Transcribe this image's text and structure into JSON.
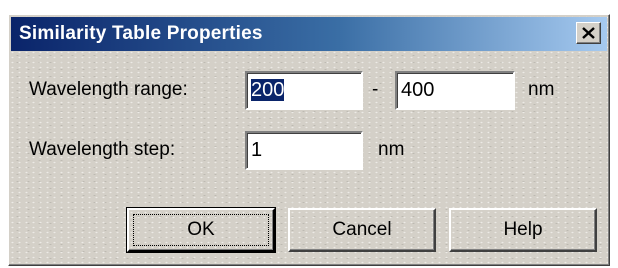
{
  "window": {
    "title": "Similarity Table Properties",
    "close_glyph": "✕"
  },
  "form": {
    "range_label": "Wavelength range:",
    "range_from": "200",
    "range_separator": "-",
    "range_to": "400",
    "range_unit": "nm",
    "step_label": "Wavelength step:",
    "step_value": "1",
    "step_unit": "nm"
  },
  "buttons": {
    "ok_label": "OK",
    "cancel_label": "Cancel",
    "help_label": "Help"
  },
  "colors": {
    "title_start": "#0a246a",
    "title_end": "#a6caf0",
    "face": "#d4d0c8",
    "selection": "#0a246a"
  }
}
